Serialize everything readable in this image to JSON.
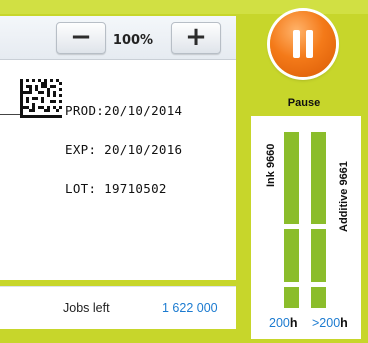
{
  "toolbar": {
    "zoom_out_label": "−",
    "zoom_in_label": "+",
    "zoom_value": "100%"
  },
  "label_preview": {
    "lines": [
      "PROD:20/10/2014",
      "EXP: 20/10/2016",
      "LOT: 19710502"
    ],
    "barcode": "2d-datamatrix"
  },
  "jobs": {
    "label": "Jobs left",
    "value": "1 622 000"
  },
  "pause": {
    "label": "Pause",
    "icon": "pause-icon",
    "color": "#f47a19"
  },
  "consumables": [
    {
      "name": "Ink 9660",
      "hours_value": "200",
      "hours_unit": "h",
      "level_blocks": 3
    },
    {
      "name": "Additive 9661",
      "hours_value": ">200",
      "hours_unit": "h",
      "level_blocks": 3
    }
  ],
  "colors": {
    "frame": "#c7d62b",
    "level": "#8bbd2b",
    "accent": "#1c7bd0"
  }
}
